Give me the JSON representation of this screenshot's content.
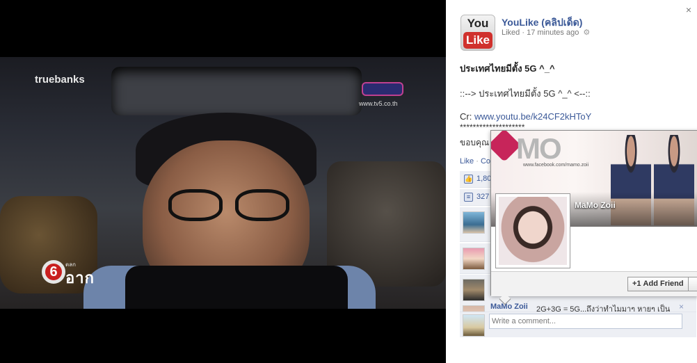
{
  "video": {
    "watermark": "truebanks",
    "channel_url": "www.tv5.co.th",
    "channel_badge": "6",
    "channel_sub": "ตลก",
    "channel_big": "อาก"
  },
  "post": {
    "close": "×",
    "logo_you": "You",
    "logo_like": "Like",
    "page_name": "YouLike (คลิปเด็ด)",
    "liked_label": "Liked",
    "time": "17 minutes ago",
    "title": "ประเทศไทยมีตั้ง 5G ^_^",
    "line1": "::--> ประเทศไทยมีตั้ง 5G ^_^ <--::",
    "cr_prefix": "Cr:",
    "cr_link": "www.youtu.be/k24CF2kHToY",
    "stars": "********************",
    "thanks": "ขอบคุณ",
    "actions": {
      "like": "Like",
      "comment": "Con"
    }
  },
  "ufi": {
    "likes": "1,80",
    "shares": "327",
    "last_comment": {
      "author": "MaMo Zoii",
      "text": "2G+3G = 5G...ถึงว่าทำไมมาๆ หายๆ เป็น"
    },
    "comment_placeholder": "Write a comment...",
    "close_x": "×"
  },
  "hovercard": {
    "brand": "MO",
    "brand_url": "www.facebook.com/mamo.zoii",
    "name": "MaMo Zoii",
    "add_friend": "Add Friend",
    "add_friend_icon": "+1"
  }
}
